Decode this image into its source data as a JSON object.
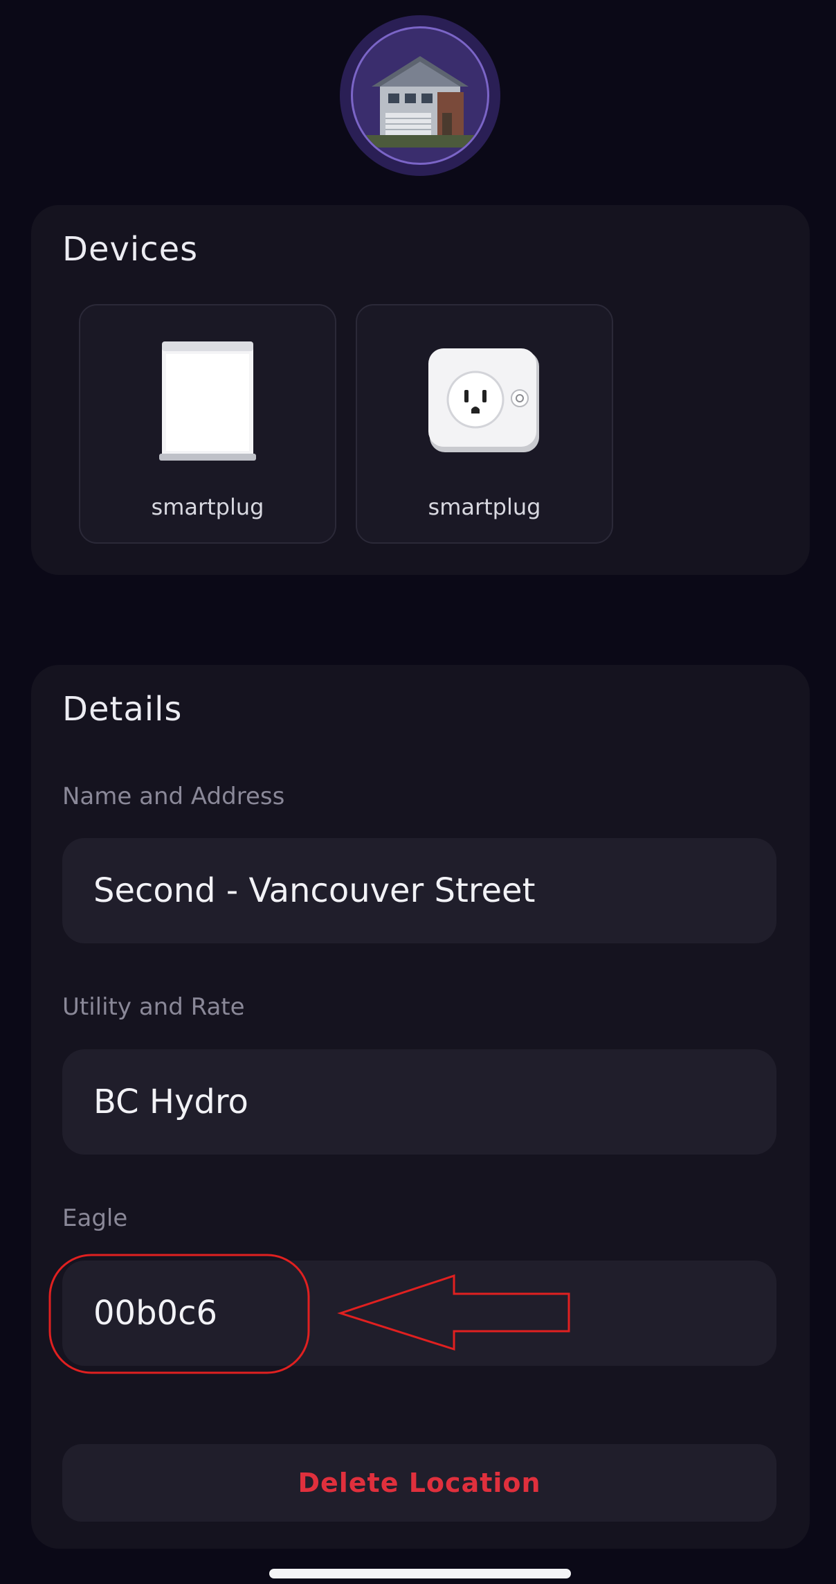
{
  "devices": {
    "title": "Devices",
    "items": [
      {
        "label": "smartplug",
        "icon": "dishwasher-icon"
      },
      {
        "label": "smartplug",
        "icon": "smart-outlet-icon"
      }
    ]
  },
  "details": {
    "title": "Details",
    "name_label": "Name and Address",
    "name_value": "Second - Vancouver Street",
    "utility_label": "Utility and Rate",
    "utility_value": "BC Hydro",
    "eagle_label": "Eagle",
    "eagle_value": "00b0c6",
    "delete_label": "Delete Location"
  },
  "colors": {
    "background": "#0b0917",
    "card": "#15131f",
    "field": "#201e2b",
    "delete": "#e0303d",
    "annotation": "#e02020"
  }
}
